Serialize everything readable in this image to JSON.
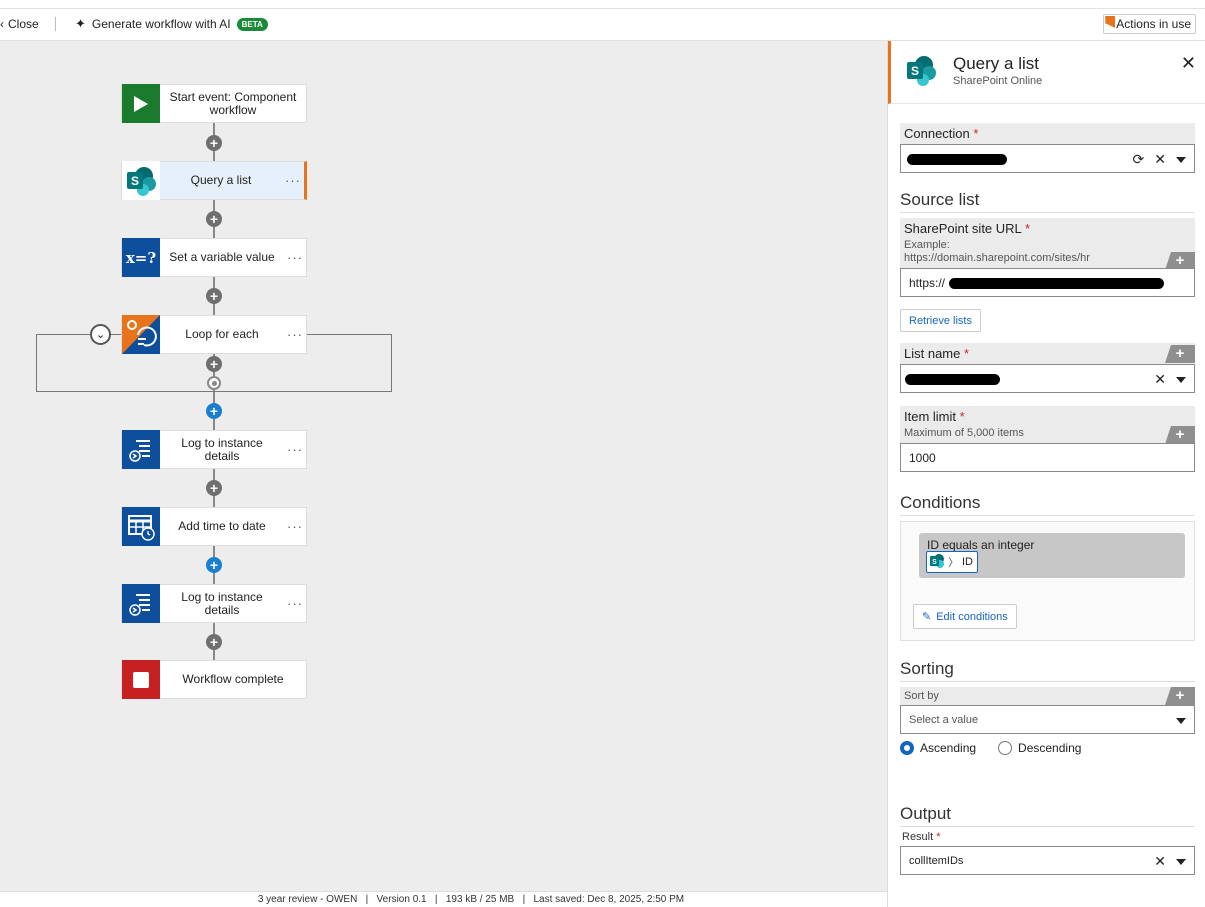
{
  "topbar": {
    "close_label": "Close",
    "generate_label": "Generate workflow with AI",
    "beta_badge": "BETA",
    "actions_label": "Actions in use"
  },
  "workflow": {
    "nodes": [
      {
        "label": "Start event: Component workflow",
        "icon": "play-icon",
        "color": "#1a7a2e"
      },
      {
        "label": "Query a list",
        "icon": "sharepoint-icon",
        "color": "#ffffff"
      },
      {
        "label": "Set a variable value",
        "icon": "variable-icon",
        "color": "#0d4f9c"
      },
      {
        "label": "Loop for each",
        "icon": "loop-icon",
        "color": "#0d4f9c"
      },
      {
        "label": "Log to instance details",
        "icon": "log-icon",
        "color": "#0d4f9c"
      },
      {
        "label": "Add time to date",
        "icon": "calendar-icon",
        "color": "#0d4f9c"
      },
      {
        "label": "Log to instance details",
        "icon": "log-icon",
        "color": "#0d4f9c"
      },
      {
        "label": "Workflow complete",
        "icon": "stop-icon",
        "color": "#c62020"
      }
    ],
    "more_glyph": "···"
  },
  "status_bar": "3 year review - OWEN   |   Version 0.1   |   193 kB / 25 MB   |   Last saved: Dec 8, 2025, 2:50 PM",
  "panel": {
    "title": "Query a list",
    "subtitle": "SharePoint Online",
    "connection": {
      "label": "Connection",
      "required": "*"
    },
    "source_list_heading": "Source list",
    "site_url": {
      "label": "SharePoint site URL",
      "required": "*",
      "hint1": "Example:",
      "hint2": "https://domain.sharepoint.com/sites/hr",
      "value_prefix": "https://"
    },
    "retrieve_label": "Retrieve lists",
    "list_name": {
      "label": "List name",
      "required": "*"
    },
    "item_limit": {
      "label": "Item limit",
      "required": "*",
      "hint": "Maximum of 5,000 items",
      "value": "1000"
    },
    "conditions_heading": "Conditions",
    "condition_text": "ID equals an integer",
    "condition_chip": "ID",
    "edit_conditions_label": "Edit conditions",
    "sorting_heading": "Sorting",
    "sort_by": {
      "label": "Sort by",
      "placeholder": "Select a value"
    },
    "ascending_label": "Ascending",
    "descending_label": "Descending",
    "output_heading": "Output",
    "result": {
      "label": "Result",
      "required": "*",
      "value": "collItemIDs"
    }
  }
}
